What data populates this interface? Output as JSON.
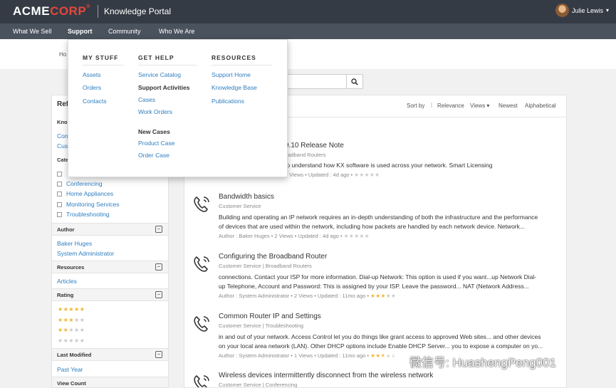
{
  "header": {
    "logo_acme": "ACME",
    "logo_corp": "CORP",
    "logo_mark": "®",
    "portal_title": "Knowledge Portal",
    "user_name": "Julie Lewis",
    "user_caret": "▾"
  },
  "nav": {
    "items": [
      "What We Sell",
      "Support",
      "Community",
      "Who We Are"
    ],
    "active": "Support"
  },
  "breadcrumb": {
    "partial": "Ho"
  },
  "dropdown": {
    "my_stuff": {
      "heading": "MY STUFF",
      "links": [
        "Assets",
        "Orders",
        "Contacts"
      ]
    },
    "get_help": {
      "heading": "GET HELP",
      "link_service_catalog": "Service Catalog",
      "support_activities_label": "Support Activities",
      "link_cases": "Cases",
      "link_work_orders": "Work Orders",
      "new_cases_label": "New Cases",
      "link_product_case": "Product Case",
      "link_order_case": "Order Case"
    },
    "resources": {
      "heading": "RESOURCES",
      "links": [
        "Support Home",
        "Knowledge Base",
        "Publications"
      ]
    }
  },
  "sidebar": {
    "refine_partial": "Ref",
    "kno_partial": "Kno",
    "link_con_partial": "Con",
    "link_cus_partial": "Cus",
    "cate_partial": "Cate",
    "categories": [
      "",
      "Conferencing",
      "Home Appliances",
      "Monitoring Services",
      "Troubleshooting"
    ],
    "author_label": "Author",
    "authors": [
      "Baker Huges",
      "System Administrator"
    ],
    "resources_label": "Resources",
    "resources_items": [
      "Articles"
    ],
    "rating_label": "Rating",
    "rating_levels": [
      5,
      3,
      2,
      0
    ],
    "last_modified_label": "Last Modified",
    "last_modified_items": [
      "Past Year"
    ],
    "view_count_label": "View Count",
    "collapse_glyph": "−"
  },
  "sort": {
    "label": "Sort by",
    "separator": "|",
    "options": [
      "Relevance",
      "Views ▾",
      "Newest",
      "Alphabetical"
    ]
  },
  "results": [
    {
      "title": "9.10 Release Note",
      "meta": "oadband Routers",
      "snippet1": "to understand how KX software is used across your network. Smart Licensing",
      "footer": "6 Views  •  Updated : 4d ago  •",
      "rating": 0
    },
    {
      "title": "Bandwidth basics",
      "meta": "Customer Service",
      "snippet1": "Building and operating an IP network requires an in-depth understanding of both the infrastructure and the performance",
      "snippet2": "of devices that are used within the network, including how packets are handled by each network device. Network...",
      "footer": "Author : Baker Huges  •  2 Views  •  Updated : 4d ago  •",
      "rating": 0
    },
    {
      "title": "Configuring the Broadband Router",
      "meta": "Customer Service  |  Broadband Routers",
      "snippet1": "connections. Contact your ISP for more information. Dial-up Network: This option is used if you want...up Network Dial-",
      "snippet2": "up Telephone, Account and Password: This is assigned by your ISP. Leave the password... NAT (Network Address...",
      "footer": "Author : System Administrator  •  2 Views  •  Updated : 11mo ago  •",
      "rating": 3
    },
    {
      "title": "Common Router IP and Settings",
      "meta": "Customer Service  |  Troubleshooting",
      "snippet1": "in and out of your network. Access Control let you do things like grant access to approved Web sites... and other devices",
      "snippet2": "on your local area network (LAN). Other DHCP options include Enable DHCP Server... you to expose a computer on yo...",
      "footer": "Author : System Administrator  •  1 Views  •  Updated : 11mo ago  •",
      "rating": 3
    },
    {
      "title": "Wireless devices intermittently disconnect from the wireless network",
      "meta": "Customer Service  |  Conferencing"
    }
  ],
  "watermark": {
    "text": "微信号: HuashengPeng001"
  },
  "colors": {
    "topbar": "#343b45",
    "navbar": "#4a525e",
    "link": "#2f7ec0",
    "brand_red": "#e2483d",
    "star": "#f1b52a"
  }
}
